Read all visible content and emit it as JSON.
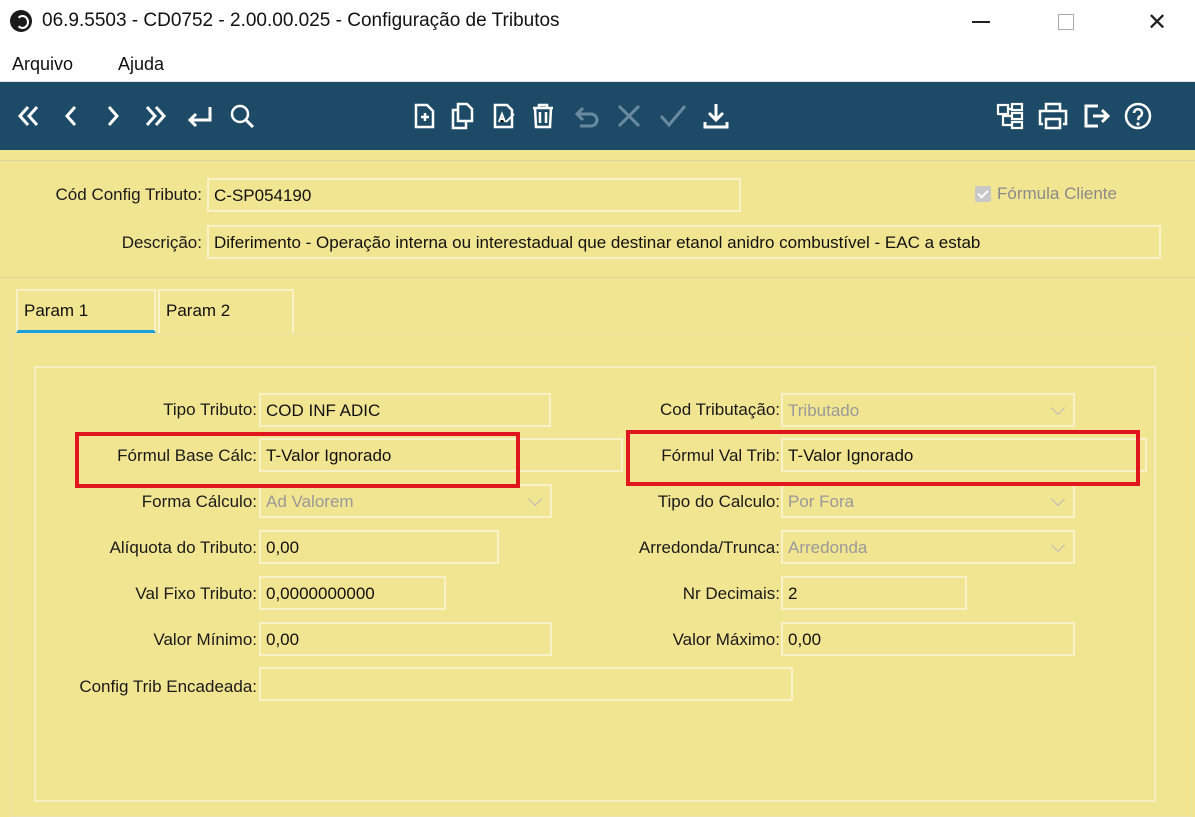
{
  "window": {
    "title": "06.9.5503 - CD0752 - 2.00.00.025 - Configuração de Tributos",
    "close_glyph": "✕"
  },
  "menu": {
    "items": [
      "Arquivo",
      "Ajuda"
    ]
  },
  "toolbar": {
    "icons": [
      "first-record-icon",
      "previous-record-icon",
      "next-record-icon",
      "last-record-icon",
      "goto-icon",
      "search-icon",
      "new-record-icon",
      "copy-record-icon",
      "edit-record-icon",
      "delete-icon",
      "undo-icon",
      "cancel-icon",
      "confirm-icon",
      "download-icon",
      "hierarchy-icon",
      "print-icon",
      "exit-icon",
      "help-icon"
    ],
    "colors": {
      "background": "#1d4a66",
      "icon": "#ffffff",
      "disabled": "#6a8aa0"
    }
  },
  "header": {
    "cod_config_label": "Cód Config Tributo:",
    "cod_config_value": "C-SP054190",
    "formula_cliente_label": "Fórmula Cliente",
    "formula_cliente_checked": true,
    "descricao_label": "Descrição:",
    "descricao_value": "Diferimento - Operação interna ou interestadual que destinar etanol anidro combustível - EAC a estab"
  },
  "tabs": [
    "Param 1",
    "Param 2"
  ],
  "form": {
    "tipo_tributo_label": "Tipo Tributo:",
    "tipo_tributo_value": "COD INF ADIC",
    "formul_base_calc_label": "Fórmul Base Cálc:",
    "formul_base_calc_value": "T-Valor Ignorado",
    "forma_calculo_label": "Forma Cálculo:",
    "forma_calculo_value": "Ad Valorem",
    "aliquota_label": "Alíquota do Tributo:",
    "aliquota_value": "0,00",
    "val_fixo_label": "Val Fixo Tributo:",
    "val_fixo_value": "0,0000000000",
    "valor_minimo_label": "Valor Mínimo:",
    "valor_minimo_value": "0,00",
    "config_trib_label": "Config Trib Encadeada:",
    "config_trib_value": "",
    "cod_tributacao_label": "Cod Tributação:",
    "cod_tributacao_value": "Tributado",
    "formul_val_trib_label": "Fórmul Val Trib:",
    "formul_val_trib_value": "T-Valor Ignorado",
    "tipo_calculo_label": "Tipo do Calculo:",
    "tipo_calculo_value": "Por Fora",
    "arredonda_label": "Arredonda/Trunca:",
    "arredonda_value": "Arredonda",
    "nr_decimais_label": "Nr Decimais:",
    "nr_decimais_value": "2",
    "valor_maximo_label": "Valor Máximo:",
    "valor_maximo_value": "0,00"
  },
  "colors": {
    "form_background": "#f2e592",
    "highlight": "#e0151d",
    "tab_underline": "#1aa0d8"
  }
}
